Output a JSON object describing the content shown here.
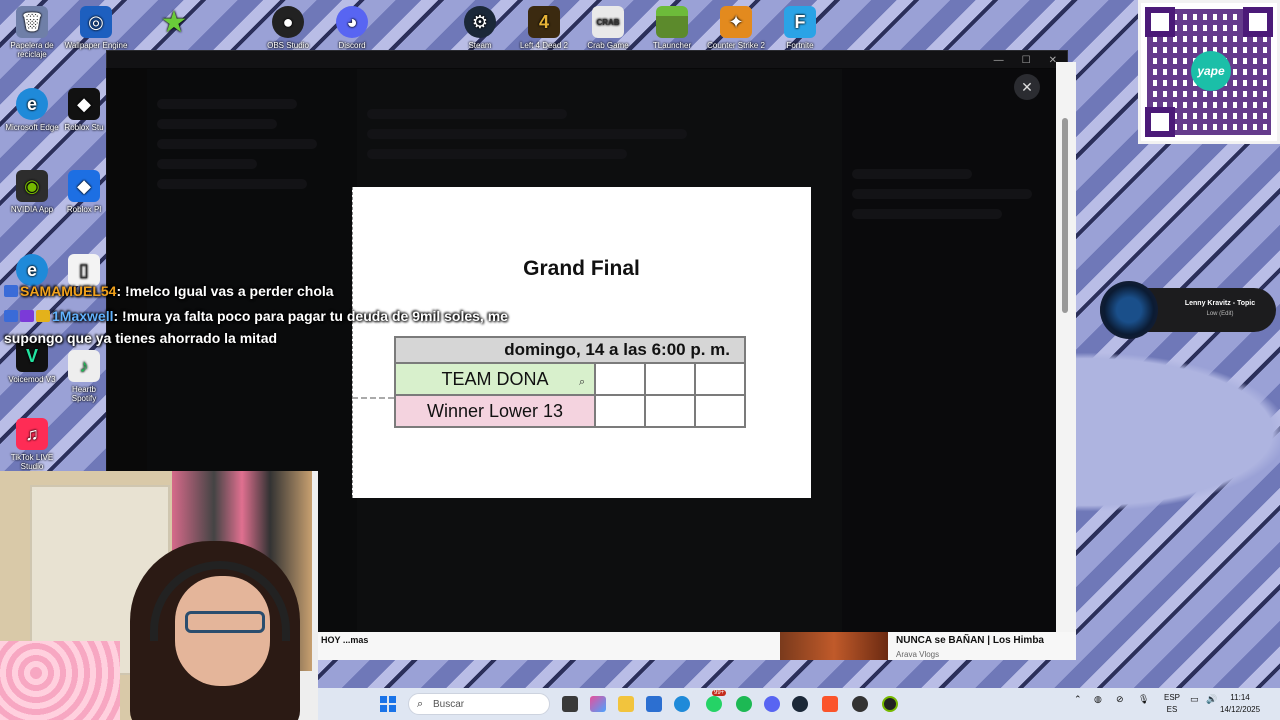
{
  "desktop": {
    "icons": [
      {
        "label": "Papelera de reciclaje",
        "icon": "recycle-bin-icon"
      },
      {
        "label": "Wallpaper Engine",
        "icon": "wallpaper-engine-icon"
      },
      {
        "label": "",
        "icon": "star-icon"
      },
      {
        "label": "OBS Studio",
        "icon": "obs-icon"
      },
      {
        "label": "Discord",
        "icon": "discord-icon"
      },
      {
        "label": "Steam",
        "icon": "steam-icon"
      },
      {
        "label": "Left 4 Dead 2",
        "icon": "left4dead-icon"
      },
      {
        "label": "Crab Game",
        "icon": "crab-game-icon"
      },
      {
        "label": "TLauncher",
        "icon": "tlauncher-icon"
      },
      {
        "label": "Counter Strike 2",
        "icon": "cs2-icon"
      },
      {
        "label": "Fortnite",
        "icon": "fortnite-icon"
      },
      {
        "label": "Microsoft Edge",
        "icon": "edge-icon"
      },
      {
        "label": "Roblox Stu",
        "icon": "roblox-studio-icon"
      },
      {
        "label": "NVIDIA App",
        "icon": "nvidia-icon"
      },
      {
        "label": "Roblox Pl",
        "icon": "roblox-player-icon"
      },
      {
        "label": "Launch",
        "icon": "launcher-icon"
      },
      {
        "label": "Voicemod V3",
        "icon": "voicemod-icon"
      },
      {
        "label": "Heartb Spotify",
        "icon": "spotify-desktop-icon"
      },
      {
        "label": "TikTok LIVE Studio",
        "icon": "tiktok-icon"
      }
    ]
  },
  "preview": {
    "title": "Grand Final",
    "match_header": "domingo, 14 a las 6:00 p. m.",
    "team1": "TEAM DONA",
    "team2": "Winner Lower 13",
    "close_label": "✕"
  },
  "chat": [
    {
      "name": "SAMAMUEL54",
      "message": ": !melco Igual vas a perder chola"
    },
    {
      "name": "1Maxwell",
      "message": ": !mura ya falta poco para pagar tu deuda de 9mil soles, me"
    },
    {
      "name": "",
      "message": "supongo que ya tienes ahorrado la mitad"
    }
  ],
  "music": {
    "title": "Lenny Kravitz - Topic",
    "subtitle": "Low (Edit)"
  },
  "browser": {
    "left_text": "HOY ...mas",
    "video_title": "NUNCA se BAÑAN | Los Himba",
    "video_channel": "Arava Vlogs"
  },
  "qr": {
    "brand": "yape"
  },
  "taskbar": {
    "search_placeholder": "Buscar",
    "lang_top": "ESP",
    "lang_bottom": "ES",
    "time": "11:14",
    "date": "14/12/2025",
    "notification_badge": "99+"
  },
  "colors": {
    "team1_bg": "#d8f0cc",
    "team2_bg": "#f4d3df",
    "header_bg": "#d6d6d6",
    "name_orange": "#f2a21c",
    "name_blue": "#62b3ff"
  }
}
